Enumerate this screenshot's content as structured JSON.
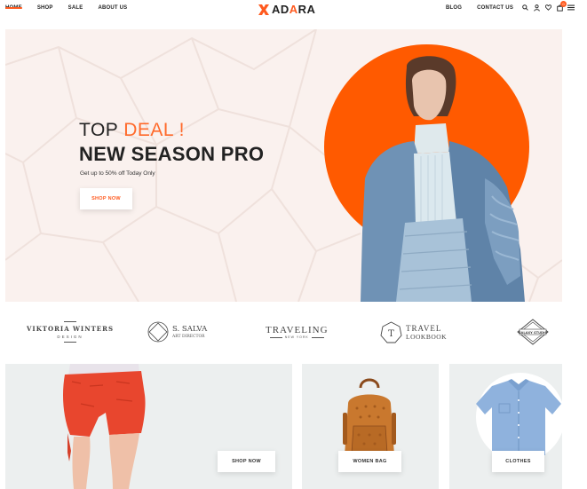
{
  "nav": {
    "left": [
      "HOME",
      "SHOP",
      "SALE",
      "ABOUT US"
    ],
    "right": [
      "BLOG",
      "CONTACT US"
    ],
    "cart_count": "0"
  },
  "logo": {
    "part1": "AD",
    "part2": "A",
    "part3": "RA"
  },
  "hero": {
    "title_prefix": "TOP ",
    "title_accent": "DEAL !",
    "headline": "NEW SEASON PRO",
    "subtitle": "Get up to 50% off Today Only",
    "button": "SHOP NOW"
  },
  "brands": {
    "b1_line1": "VIKTORIA WINTERS",
    "b1_line2": "DESIGN",
    "b2_name": "S. SALVA",
    "b2_sub": "ART DIRECTOR",
    "b2_mono": "S A",
    "b3_name": "TRAVELING",
    "b3_sub": "NEW YORK",
    "b4_letter": "T",
    "b4_line1": "TRAVEL",
    "b4_line2": "LOOKBOOK",
    "b5_name": "GALAXY STUDIO"
  },
  "cards": {
    "c1": "SHOP NOW",
    "c2": "WOMEN BAG",
    "c3": "CLOTHES"
  },
  "colors": {
    "accent": "#ff5a1f",
    "hero_bg": "#faf1ee",
    "card_bg": "#ecefef"
  }
}
